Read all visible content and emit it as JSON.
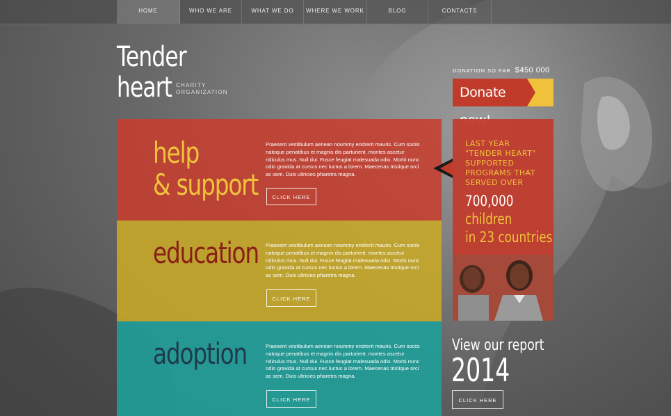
{
  "nav": {
    "items": [
      {
        "label": "HOME",
        "active": true
      },
      {
        "label": "WHO WE ARE",
        "active": false
      },
      {
        "label": "WHAT WE DO",
        "active": false
      },
      {
        "label": "WHERE WE WORK",
        "active": false
      },
      {
        "label": "BLOG",
        "active": false
      },
      {
        "label": "CONTACTS",
        "active": false
      }
    ]
  },
  "logo": {
    "line1": "Tender",
    "line2": "heart",
    "sub_line1": "CHARITY",
    "sub_line2": "ORGANIZATION"
  },
  "donation": {
    "label": "DONATION SO FAR",
    "amount": "$450 000",
    "button": "Donate now!"
  },
  "panels": [
    {
      "heading_line1": "help",
      "heading_line2": "& support",
      "text": "Praesent vestibulum aenean noummy endrerit mauris. Cum sociis natoque penatibus et magnis dis parturient. montes ascetur ridiculus mus. Null dui. Fusce feugiat malesuada odio. Morbi nunc odio gravida at cursus nec luctus a lorem. Maecenas tristique orci ac sem. Duis ultricies pharetra magna.",
      "button": "CLICK HERE"
    },
    {
      "heading_line1": "education",
      "text": "Praesent vestibulum aenean noummy endrerit mauris. Cum sociis natoque penatibus et magnis dis parturient. montes ascetur ridiculus mus. Null dui. Fusce feugiat malesuada odio. Morbi nunc odio gravida at cursus nec luctus a lorem. Maecenas tristique orci ac sem. Duis ultricies pharetra magna.",
      "button": "CLICK HERE"
    },
    {
      "heading_line1": "adoption",
      "text": "Praesent vestibulum aenean noummy endrerit mauris. Cum sociis natoque penatibus et magnis dis parturient. montes ascetur ridiculus mus. Null dui. Fusce feugiat malesuada odio. Morbi nunc odio gravida at cursus nec luctus a lorem. Maecenas tristique orci ac sem. Duis ultricies pharetra magna.",
      "button": "CLICK HERE"
    }
  ],
  "stats": {
    "intro": "LAST YEAR \"TENDER HEART\" SUPPORTED PROGRAMS THAT SERVED OVER",
    "number": "700,000",
    "line2": "children",
    "line3": "in 23 countries"
  },
  "report": {
    "title": "View our report",
    "year": "2014",
    "button": "CLICK HERE"
  },
  "colors": {
    "red": "#c13b2b",
    "yellow": "#f0c23b",
    "mustard": "#c8aa28",
    "teal": "#1ea09b",
    "heading_red": "#8a1e17",
    "heading_teal": "#1f3a4a"
  }
}
